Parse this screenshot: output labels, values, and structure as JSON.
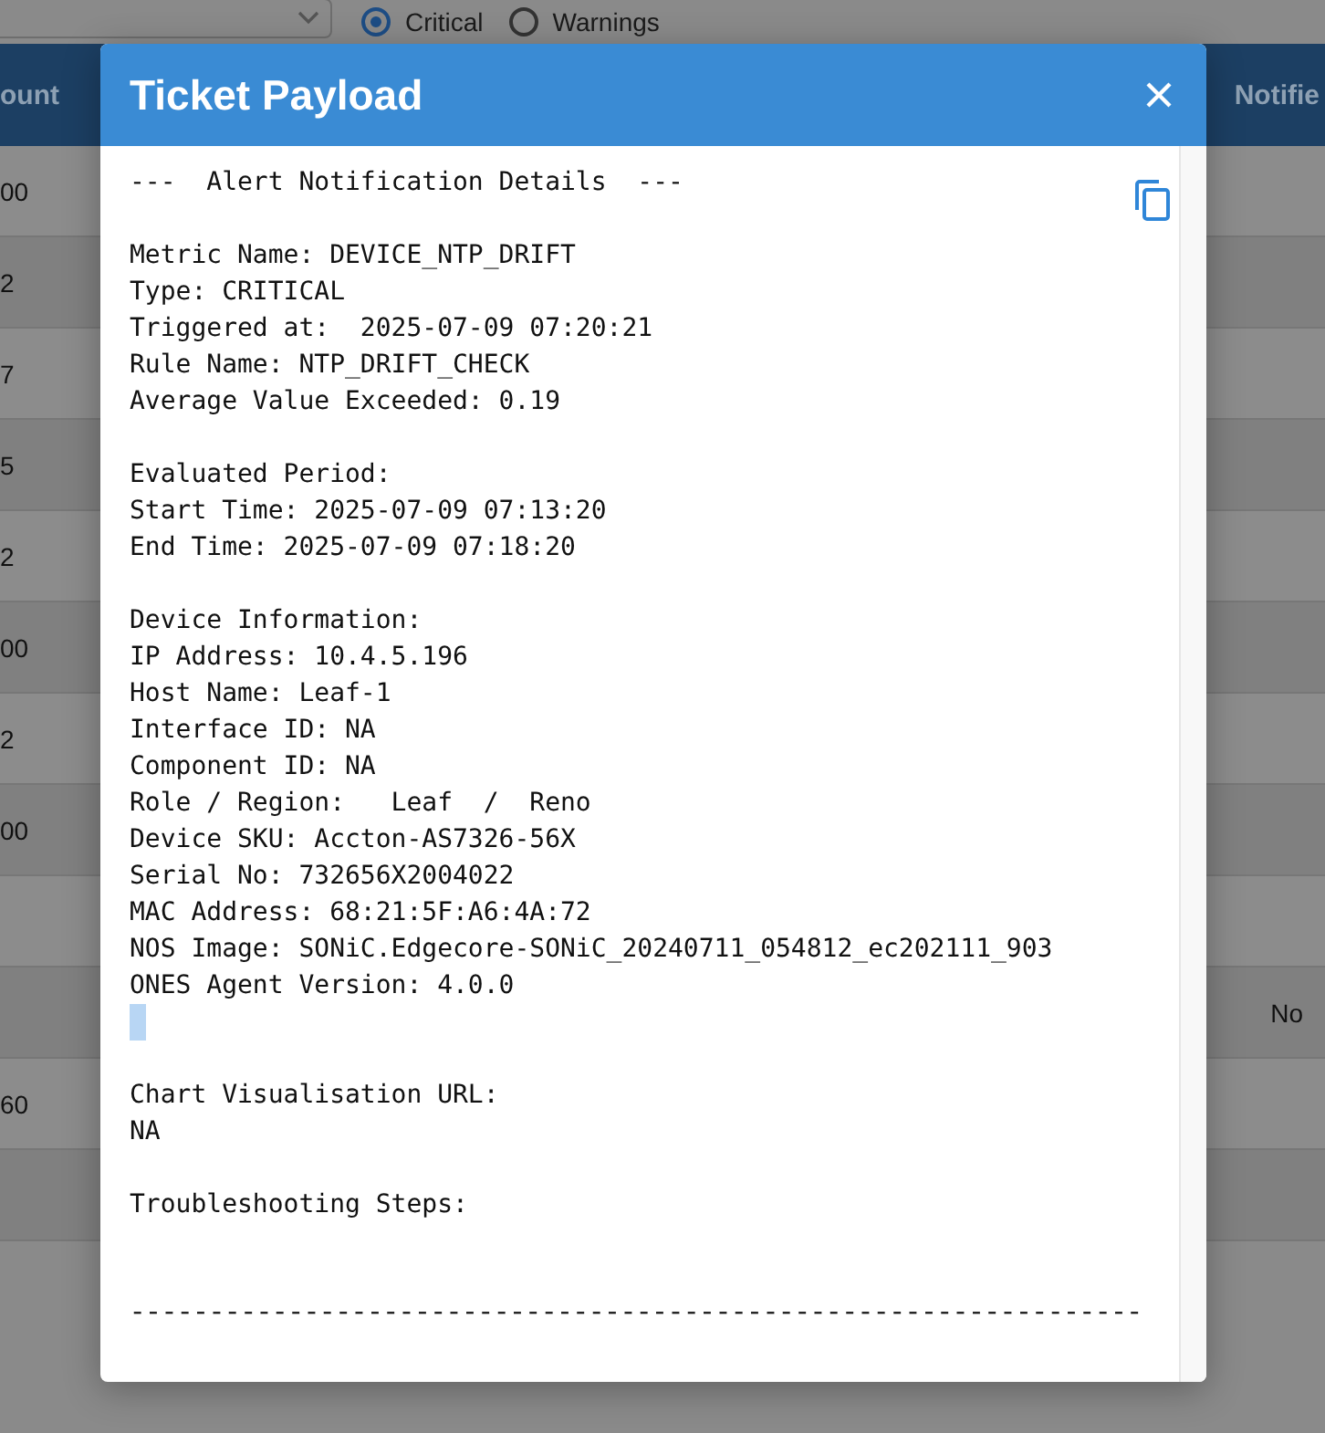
{
  "filter": {
    "options": [
      {
        "label": "Critical",
        "selected": true
      },
      {
        "label": "Warnings",
        "selected": false
      }
    ]
  },
  "table": {
    "columns": [
      "ount",
      "Notifie"
    ],
    "rows": [
      {
        "column_1": "00"
      },
      {
        "column_1": "2"
      },
      {
        "column_1": "7"
      },
      {
        "column_1": "5"
      },
      {
        "column_1": "2"
      },
      {
        "column_1": "00"
      },
      {
        "column_1": "2"
      },
      {
        "column_1": "00"
      },
      {},
      {
        "column_2": "No"
      },
      {
        "column_1": "60"
      },
      {}
    ]
  },
  "dialog": {
    "title": "Ticket Payload",
    "blocks": [
      [
        "---  Alert Notification Details  ---"
      ],
      [
        "Metric Name: DEVICE_NTP_DRIFT",
        "Type: CRITICAL",
        "Triggered at:  2025-07-09 07:20:21",
        "Rule Name: NTP_DRIFT_CHECK",
        "Average Value Exceeded: 0.19"
      ],
      [
        "Evaluated Period:",
        "Start Time: 2025-07-09 07:13:20",
        "End Time: 2025-07-09 07:18:20"
      ],
      [
        "Device Information:",
        "IP Address: 10.4.5.196",
        "Host Name: Leaf-1",
        "Interface ID: NA",
        "Component ID: NA",
        "Role / Region:   Leaf  /  Reno",
        "Device SKU: Accton-AS7326-56X",
        "Serial No: 732656X2004022",
        "MAC Address: 68:21:5F:A6:4A:72",
        "NOS Image: SONiC.Edgecore-SONiC_20240711_054812_ec202111_903",
        "ONES Agent Version: 4.0.0"
      ],
      [
        "Chart Visualisation URL:",
        "NA"
      ],
      [
        "Troubleshooting Steps:"
      ]
    ],
    "rule": "----------------------------------------------------------------"
  }
}
